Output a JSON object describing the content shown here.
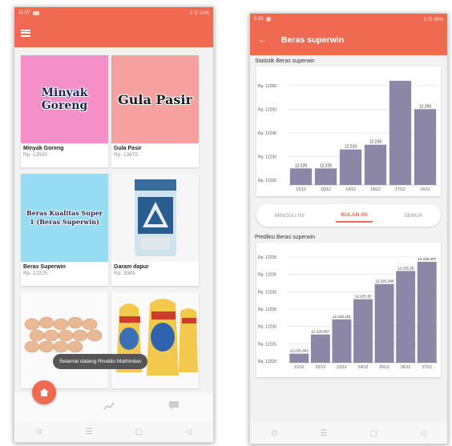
{
  "phone1": {
    "statusbar": {
      "time": "11.57",
      "right": "0 ☰ 41%"
    },
    "products": [
      {
        "image_text": "Minyak Goreng",
        "name": "Minyak Goreng",
        "price": "Rp. 13500",
        "bg": "#f58fc8"
      },
      {
        "image_text": "Gula Pasir",
        "name": "Gula Pasir",
        "price": "Rp. 13875",
        "bg": "#f6a0a0"
      },
      {
        "image_text": "Beras Kualitas Super 1 (Beras Superwin)",
        "name": "Beras Superwin",
        "price": "Rp. 12225",
        "bg": "#96ddf3"
      },
      {
        "image_text": "",
        "name": "Garam dapur",
        "price": "Rp. 3083",
        "bg": "#f6f6f6"
      }
    ],
    "toast": "Selamat datang Rivaldo Mathindas",
    "icons": {
      "menu": "hamburger-icon",
      "home": "home-icon",
      "trend": "trend-icon",
      "chat": "chat-icon"
    }
  },
  "phone2": {
    "statusbar": {
      "time": "6.55",
      "right": "0 ☰ 45%"
    },
    "title": "Beras superwin",
    "stats_label": "Statistik Beras superwin",
    "predict_label": "Prediksi Beras superwin",
    "tabs": [
      "MINGGU INI",
      "BULAN INI",
      "SEMUA"
    ],
    "active_tab": 1,
    "colors": {
      "accent": "#f06a52",
      "bar": "#8c87a6"
    }
  },
  "chart_data": [
    {
      "type": "bar",
      "title": "Statistik Beras superwin",
      "categories": [
        "21/12",
        "20/12",
        "19/12",
        "18/12",
        "17/12",
        "16/12"
      ],
      "values": [
        12225,
        12225,
        12233,
        12235,
        12262,
        12250
      ],
      "data_labels": [
        "12.225",
        "12.225",
        "12.233",
        "12.235",
        "",
        "12.250"
      ],
      "y_ticks": [
        "Rp. 12260",
        "Rp. 12250",
        "Rp. 12240",
        "Rp. 12230",
        "Rp. 12220"
      ],
      "ylim": [
        12218,
        12264
      ],
      "grid": true
    },
    {
      "type": "bar",
      "title": "Prediksi Beras superwin",
      "categories": [
        "21/12",
        "22/12",
        "23/12",
        "24/12",
        "25/12",
        "26/12",
        "27/12"
      ],
      "values": [
        12225.302,
        12225.067,
        12225.161,
        12225.35,
        12225.298,
        12225.35,
        12225.407
      ],
      "data_labels": [
        "12.225,302",
        "12.225,067",
        "12.225,161",
        "12.225,35",
        "12.225,298",
        "12.225,35",
        "12.225,407"
      ],
      "bar_heights_frac": [
        0.09,
        0.28,
        0.43,
        0.63,
        0.78,
        0.91,
        1.0
      ],
      "y_ticks": [
        "Rp. 12235",
        "Rp. 12235",
        "Rp. 12235",
        "Rp. 12235",
        "Rp. 12235",
        "Rp. 12225",
        "Rp. 12225"
      ],
      "grid": true
    }
  ]
}
